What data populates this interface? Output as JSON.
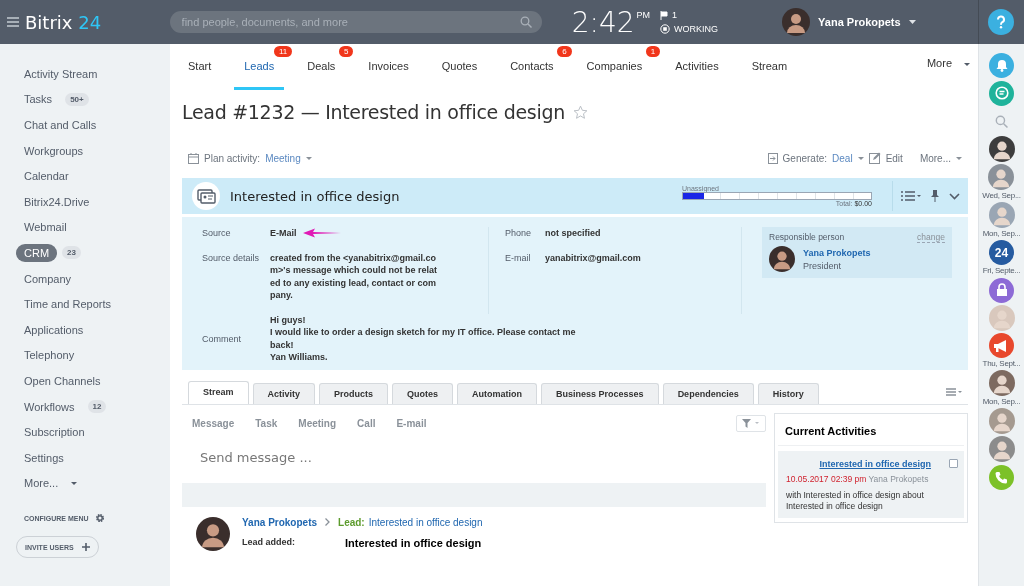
{
  "header": {
    "logo": "Bitrix",
    "logo_accent": "24",
    "search": {
      "placeholder": "find people, documents, and more"
    },
    "clock": "2:42",
    "ampm": "PM",
    "flag_count": "1",
    "status": "WORKING",
    "user": "Yana Prokopets"
  },
  "sidebar": {
    "items": [
      {
        "label": "Activity Stream",
        "selected": false
      },
      {
        "label": "Tasks",
        "badge": "50+",
        "selected": false
      },
      {
        "label": "Chat and Calls",
        "selected": false
      },
      {
        "label": "Workgroups",
        "selected": false
      },
      {
        "label": "Calendar",
        "selected": false
      },
      {
        "label": "Bitrix24.Drive",
        "selected": false
      },
      {
        "label": "Webmail",
        "selected": false
      },
      {
        "label": "CRM",
        "badge": "23",
        "selected": true
      },
      {
        "label": "Company",
        "selected": false
      },
      {
        "label": "Time and Reports",
        "selected": false
      },
      {
        "label": "Applications",
        "selected": false
      },
      {
        "label": "Telephony",
        "selected": false
      },
      {
        "label": "Open Channels",
        "selected": false
      },
      {
        "label": "Workflows",
        "badge": "12",
        "selected": false
      },
      {
        "label": "Subscription",
        "selected": false
      },
      {
        "label": "Settings",
        "selected": false
      },
      {
        "label": "More...",
        "selected": false,
        "dropdown": true
      }
    ],
    "configure": "CONFIGURE MENU",
    "invite": "INVITE USERS"
  },
  "nav": {
    "tabs": [
      {
        "label": "Start",
        "selected": false
      },
      {
        "label": "Leads",
        "count": "11",
        "selected": true
      },
      {
        "label": "Deals",
        "count": "5",
        "selected": false
      },
      {
        "label": "Invoices",
        "selected": false
      },
      {
        "label": "Quotes",
        "selected": false
      },
      {
        "label": "Contacts",
        "count": "6",
        "selected": false
      },
      {
        "label": "Companies",
        "count": "1",
        "selected": false
      },
      {
        "label": "Activities",
        "selected": false
      },
      {
        "label": "Stream",
        "selected": false
      }
    ],
    "more": "More"
  },
  "title": "Lead #1232 — Interested in office design",
  "toolbar": {
    "plan_label": "Plan activity:",
    "plan_value": "Meeting",
    "generate_label": "Generate:",
    "generate_value": "Deal",
    "edit": "Edit",
    "more": "More..."
  },
  "card": {
    "title": "Interested in office design",
    "stage": "Unassigned",
    "level": 0.11,
    "total_label": "Total:",
    "total": "$0.00",
    "fields": [
      {
        "label": "Source",
        "value": "E-Mail",
        "marked": true
      },
      {
        "label": "Source details",
        "value": "created from the <yanabitrix@gmail.com>'s message which could not be related to any existing lead, contact or company.",
        "marked": false
      }
    ],
    "contacts": [
      {
        "label": "Phone",
        "value": "not specified"
      },
      {
        "label": "E-mail",
        "value": "yanabitrix@gmail.com"
      }
    ],
    "comment": {
      "label": "Comment",
      "lines": [
        "Hi guys!",
        "I would like to order a design sketch for my IT office. Please contact me back!",
        "Yan Williams."
      ]
    },
    "responsible": {
      "label": "Responsible person",
      "change": "change",
      "name": "Yana Prokopets",
      "role": "President"
    }
  },
  "tabs": [
    {
      "label": "Stream",
      "selected": true
    },
    {
      "label": "Activity",
      "selected": false
    },
    {
      "label": "Products",
      "selected": false
    },
    {
      "label": "Quotes",
      "selected": false
    },
    {
      "label": "Automation",
      "selected": false
    },
    {
      "label": "Business Processes",
      "selected": false
    },
    {
      "label": "Dependencies",
      "selected": false
    },
    {
      "label": "History",
      "selected": false
    }
  ],
  "actions": [
    "Message",
    "Task",
    "Meeting",
    "Call",
    "E-mail"
  ],
  "message": {
    "placeholder": "Send message ..."
  },
  "current": {
    "title": "Current Activities",
    "item": {
      "title": "Interested in office design",
      "date": "10.05.2017 02:39 pm",
      "author": "Yana Prokopets",
      "text": "with Interested in office design about Interested in office design",
      "checked": false
    }
  },
  "post": {
    "author": "Yana Prokopets",
    "entity_label": "Lead:",
    "entity": "Interested in office design",
    "field": "Lead added:",
    "value": "Interested in office design"
  },
  "rail": [
    {
      "kind": "bell"
    },
    {
      "kind": "chat"
    },
    {
      "kind": "search"
    },
    {
      "kind": "avatar",
      "color": "#3d3d3d"
    },
    {
      "kind": "avatar",
      "color": "#8a9199",
      "label": "Wed, Sep..."
    },
    {
      "kind": "avatar",
      "color": "#9aa6b4",
      "label": "Mon, Sep..."
    },
    {
      "kind": "calendar",
      "text": "24",
      "label": "Fri, Septe..."
    },
    {
      "kind": "lock"
    },
    {
      "kind": "avatar",
      "color": "#d9c8bd"
    },
    {
      "kind": "megaphone",
      "label": "Thu, Sept..."
    },
    {
      "kind": "avatar",
      "color": "#7d6a60",
      "label": "Mon, Sep..."
    },
    {
      "kind": "avatar",
      "color": "#a59a90"
    },
    {
      "kind": "avatar",
      "color": "#8c8c8c"
    },
    {
      "kind": "phone"
    }
  ]
}
